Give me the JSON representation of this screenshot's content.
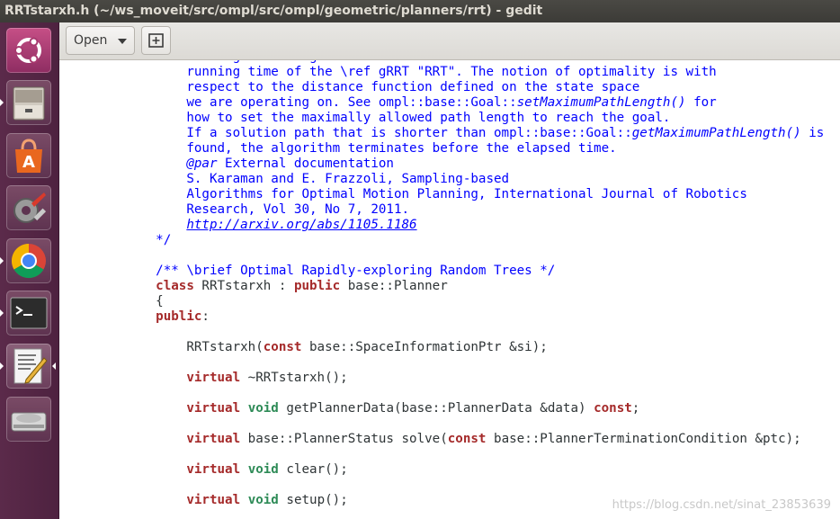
{
  "window": {
    "title": "RRTstarxh.h (~/ws_moveit/src/ompl/src/ompl/geometric/planners/rrt) - gedit"
  },
  "launcher": {
    "items": [
      {
        "name": "ubuntu-logo-icon"
      },
      {
        "name": "file-manager-icon"
      },
      {
        "name": "software-center-icon"
      },
      {
        "name": "system-settings-icon"
      },
      {
        "name": "chrome-icon"
      },
      {
        "name": "terminal-icon"
      },
      {
        "name": "text-editor-icon"
      },
      {
        "name": "disk-drive-icon"
      }
    ]
  },
  "toolbar": {
    "open_label": "Open",
    "new_tab_icon": "new-tab-icon"
  },
  "code": {
    "lines": [
      [
        "        ",
        {
          "c": "cmt",
          "t": "running time to guaranteed to be a constant factor of the"
        }
      ],
      [
        "        ",
        {
          "c": "cmt",
          "t": "running time of the \\ref gRRT \"RRT\". The notion of optimality is with"
        }
      ],
      [
        "        ",
        {
          "c": "cmt",
          "t": "respect to the distance function defined on the state space"
        }
      ],
      [
        "        ",
        {
          "c": "cmt",
          "t": "we are operating on. See ompl::base::Goal::"
        },
        {
          "c": "cmt it",
          "t": "setMaximumPathLength()"
        },
        {
          "c": "cmt",
          "t": " for"
        }
      ],
      [
        "        ",
        {
          "c": "cmt",
          "t": "how to set the maximally allowed path length to reach the goal."
        }
      ],
      [
        "        ",
        {
          "c": "cmt",
          "t": "If a solution path that is shorter than ompl::base::Goal::"
        },
        {
          "c": "cmt it",
          "t": "getMaximumPathLength()"
        },
        {
          "c": "cmt",
          "t": " is"
        }
      ],
      [
        "        ",
        {
          "c": "cmt",
          "t": "found, the algorithm terminates before the elapsed time."
        }
      ],
      [
        "        ",
        {
          "c": "cmt it",
          "t": "@par"
        },
        {
          "c": "cmt",
          "t": " External documentation"
        }
      ],
      [
        "        ",
        {
          "c": "cmt",
          "t": "S. Karaman and E. Frazzoli, Sampling-based"
        }
      ],
      [
        "        ",
        {
          "c": "cmt",
          "t": "Algorithms for Optimal Motion Planning, International Journal of Robotics"
        }
      ],
      [
        "        ",
        {
          "c": "cmt",
          "t": "Research, Vol 30, No 7, 2011."
        }
      ],
      [
        "        ",
        {
          "c": "cmt url",
          "t": "http://arxiv.org/abs/1105.1186"
        }
      ],
      [
        "    ",
        {
          "c": "cmt",
          "t": "*/"
        }
      ],
      [
        ""
      ],
      [
        "    ",
        {
          "c": "cmt",
          "t": "/** \\brief Optimal Rapidly-exploring Random Trees */"
        }
      ],
      [
        "    ",
        {
          "c": "kw",
          "t": "class"
        },
        " RRTstarxh : ",
        {
          "c": "kw",
          "t": "public"
        },
        " base::Planner"
      ],
      [
        "    {"
      ],
      [
        "    ",
        {
          "c": "kw",
          "t": "public"
        },
        ":"
      ],
      [
        ""
      ],
      [
        "        RRTstarxh(",
        {
          "c": "kw",
          "t": "const"
        },
        " base::SpaceInformationPtr &si);"
      ],
      [
        ""
      ],
      [
        "        ",
        {
          "c": "kw",
          "t": "virtual"
        },
        " ~RRTstarxh();"
      ],
      [
        ""
      ],
      [
        "        ",
        {
          "c": "kw",
          "t": "virtual"
        },
        " ",
        {
          "c": "ty",
          "t": "void"
        },
        " getPlannerData(base::PlannerData &data) ",
        {
          "c": "kw",
          "t": "const"
        },
        ";"
      ],
      [
        ""
      ],
      [
        "        ",
        {
          "c": "kw",
          "t": "virtual"
        },
        " base::PlannerStatus solve(",
        {
          "c": "kw",
          "t": "const"
        },
        " base::PlannerTerminationCondition &ptc);"
      ],
      [
        ""
      ],
      [
        "        ",
        {
          "c": "kw",
          "t": "virtual"
        },
        " ",
        {
          "c": "ty",
          "t": "void"
        },
        " clear();"
      ],
      [
        ""
      ],
      [
        "        ",
        {
          "c": "kw",
          "t": "virtual"
        },
        " ",
        {
          "c": "ty",
          "t": "void"
        },
        " setup();"
      ],
      [
        ""
      ]
    ]
  },
  "watermark": "https://blog.csdn.net/sinat_23853639"
}
